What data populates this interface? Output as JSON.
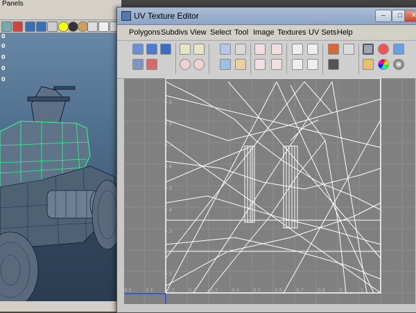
{
  "viewport": {
    "menu_label": "Panels",
    "axis_readouts": [
      "0",
      "0",
      "0",
      "0",
      "0"
    ]
  },
  "uv_editor": {
    "title": "UV Texture Editor",
    "window_buttons": {
      "minimize": "–",
      "maximize": "□",
      "close": "✕"
    },
    "menus": [
      "Polygons",
      "Subdivs",
      "View",
      "Select",
      "Tool",
      "Image",
      "Textures",
      "UV Sets",
      "Help"
    ],
    "toolbar_icons": [
      "uv-grid-icon",
      "uv-lattice-icon",
      "uv-smudge-icon",
      "flip-u-icon",
      "flip-v-icon",
      "rotate-ccw-icon",
      "rotate-cw-icon",
      "cut-uv-icon",
      "sew-uv-icon",
      "move-sew-icon",
      "merge-uv-icon",
      "align-u-min-icon",
      "align-u-max-icon",
      "align-v-min-icon",
      "align-v-max-icon",
      "snap-top-left-icon",
      "snap-top-right-icon",
      "snap-bottom-left-icon",
      "snap-bottom-right-icon",
      "image-display-icon",
      "dim-image-icon",
      "unfiltered-icon",
      "grid-toggle-icon",
      "pixel-snap-icon",
      "shade-uv-icon",
      "isolate-icon",
      "color-icon",
      "checker-icon"
    ],
    "colors": {
      "grid_bg": "#808080",
      "grid_line": "#8e8e8e",
      "uv_line": "#ffffff",
      "axis_highlight": "#2f5fcc"
    }
  },
  "grid_labels": {
    "v_ticks": [
      "1",
      "0.9",
      "0.8",
      "0.7",
      "0.6",
      "0.5",
      "0.4",
      "0.3",
      "0.2",
      "0.1"
    ],
    "u_ticks": [
      "0.2",
      "0.1",
      "0.1",
      "0.2",
      "0.3",
      "0.4",
      "0.5",
      "0.6",
      "0.7",
      "0.8",
      "0.9",
      "1"
    ]
  }
}
